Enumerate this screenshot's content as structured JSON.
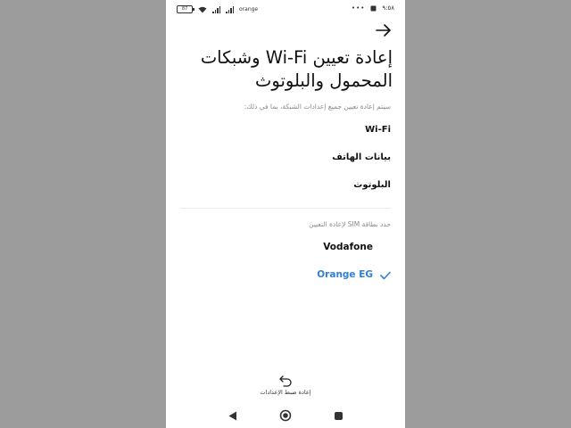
{
  "status_bar": {
    "battery": "87",
    "carrier": "orange",
    "time": "٩:٥٨",
    "dots": "•••"
  },
  "page": {
    "title": "إعادة تعيين Wi-Fi وشبكات المحمول والبلوتوث",
    "subtitle": "سيتم إعادة تعيين جميع إعدادات الشبكة، بما في ذلك:",
    "items": [
      {
        "label": "Wi-Fi"
      },
      {
        "label": "بيانات الهاتف"
      },
      {
        "label": "البلوتوث"
      }
    ],
    "sim_label": "حدد بطاقة SIM لإعادة التعيين",
    "sims": [
      {
        "name": "Vodafone",
        "selected": false
      },
      {
        "name": "Orange EG",
        "selected": true
      }
    ],
    "reset_button_label": "إعادة ضبط الإعدادات"
  },
  "icons": {
    "back": "arrow-right-icon",
    "check": "checkmark-icon",
    "reset": "undo-icon"
  },
  "colors": {
    "accent": "#2f7fd8",
    "background": "#9c9c9c",
    "screen": "#ffffff"
  }
}
